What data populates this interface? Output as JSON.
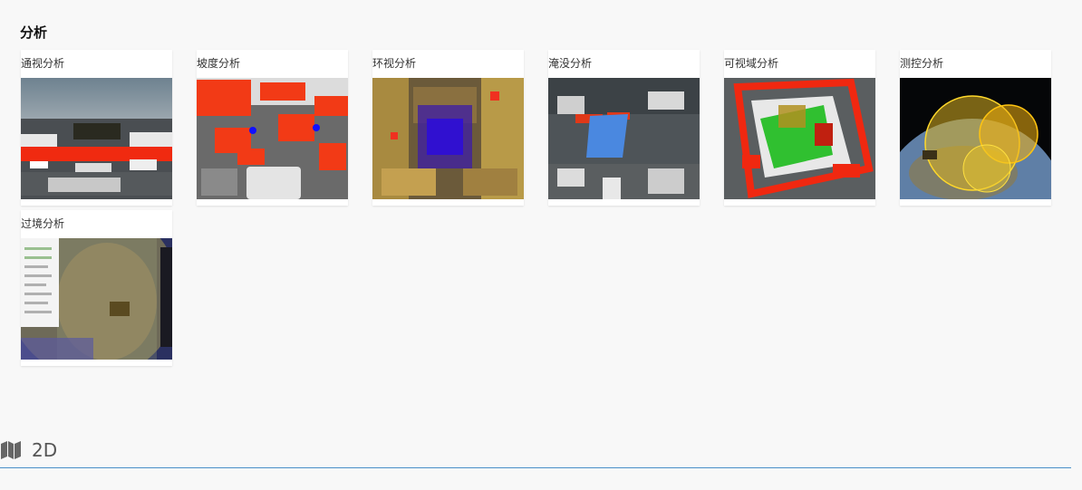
{
  "section": {
    "title": "分析"
  },
  "cards": [
    {
      "label": "通视分析",
      "icon": "line-of-sight-thumbnail"
    },
    {
      "label": "坡度分析",
      "icon": "slope-thumbnail"
    },
    {
      "label": "环视分析",
      "icon": "viewshed-around-thumbnail"
    },
    {
      "label": "淹没分析",
      "icon": "flood-thumbnail"
    },
    {
      "label": "可视域分析",
      "icon": "visible-area-thumbnail"
    },
    {
      "label": "测控分析",
      "icon": "tracking-control-thumbnail"
    },
    {
      "label": "过境分析",
      "icon": "transit-thumbnail"
    }
  ],
  "footer": {
    "label": "2D",
    "icon": "map-icon"
  }
}
